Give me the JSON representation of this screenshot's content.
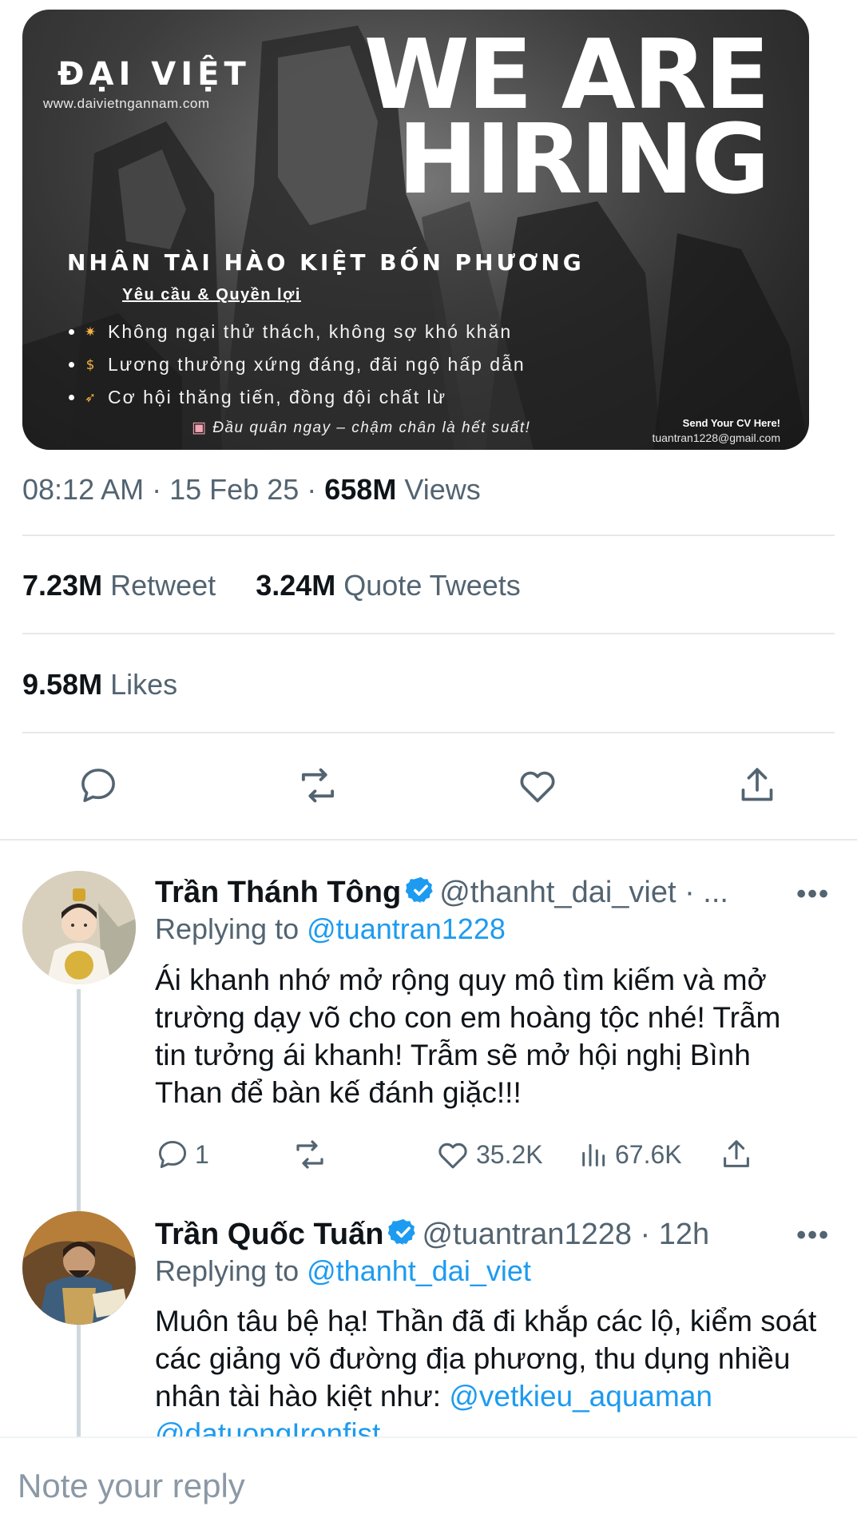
{
  "media": {
    "brand": "ĐẠI VIỆT",
    "url": "www.daivietngannam.com",
    "headline": [
      "WE ARE",
      "HIRING"
    ],
    "slogan": "NHÂN TÀI HÀO KIỆT BỐN PHƯƠNG",
    "requirements_title": "Yêu cầu & Quyền lợi",
    "bullets": [
      {
        "icon": "sparkle-icon",
        "text": "Không ngại thử thách, không sợ khó khăn"
      },
      {
        "icon": "money-bag-icon",
        "text": "Lương thưởng xứng đáng, đãi ngộ hấp dẫn"
      },
      {
        "icon": "rocket-icon",
        "text": "Cơ hội thăng tiến, đồng đội chất lừ"
      }
    ],
    "apply": "Đầu quân ngay – chậm chân là hết suất!",
    "cv_label": "Send Your CV Here!",
    "cv_email": "tuantran1228@gmail.com"
  },
  "tweet_meta": {
    "time": "08:12 AM",
    "date": "15 Feb 25",
    "views_count": "658M",
    "views_label": "Views"
  },
  "stats": {
    "retweets_count": "7.23M",
    "retweets_label": "Retweet",
    "quotes_count": "3.24M",
    "quotes_label": "Quote Tweets",
    "likes_count": "9.58M",
    "likes_label": "Likes"
  },
  "actions": [
    "reply-icon",
    "retweet-icon",
    "like-icon",
    "share-icon"
  ],
  "replies": [
    {
      "name": "Trần Thánh Tông",
      "handle": "@thanht_dai_viet · ...",
      "replying_label": "Replying to",
      "replying_to": "@tuantran1228",
      "text": "Ái khanh nhớ mở rộng quy mô tìm kiếm và mở trường dạy võ cho con em hoàng tộc nhé! Trẫm tin tưởng ái khanh! Trẫm sẽ mở hội nghị Bình Than để bàn kế đánh giặc!!!",
      "reply_count": "1",
      "like_count": "35.2K",
      "view_count": "67.6K"
    },
    {
      "name": "Trần Quốc Tuấn",
      "handle": "@tuantran1228 · 12h",
      "replying_label": "Replying to",
      "replying_to": "@thanht_dai_viet",
      "text": "Muôn tâu bệ hạ! Thần đã đi khắp các lộ, kiểm soát các giảng võ đường địa phương, thu dụng nhiều nhân tài hào kiệt như:",
      "mentions": "@vetkieu_aquaman @datuongIronfist"
    }
  ],
  "composer": {
    "placeholder": "Note your reply"
  },
  "colors": {
    "accent": "#1d9bf0",
    "secondary_text": "#536471",
    "divider": "#e6e8ea"
  }
}
